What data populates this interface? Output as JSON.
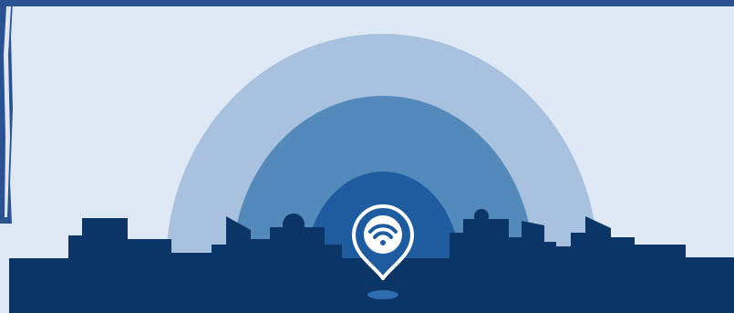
{
  "colors": {
    "background": "#dfe9f5",
    "frame": "#2a5293",
    "arc_outer": "#a8c1de",
    "arc_middle": "#5389bb",
    "arc_inner": "#1f5c9f",
    "skyline": "#0b3567",
    "pin_fill": "#1f5c9f",
    "pin_stroke": "#ffffff",
    "wifi_icon": "#1f5c9f",
    "pin_shadow": "#2f6db1"
  },
  "icons": {
    "pin": "location-pin-icon",
    "wifi": "wifi-icon"
  }
}
